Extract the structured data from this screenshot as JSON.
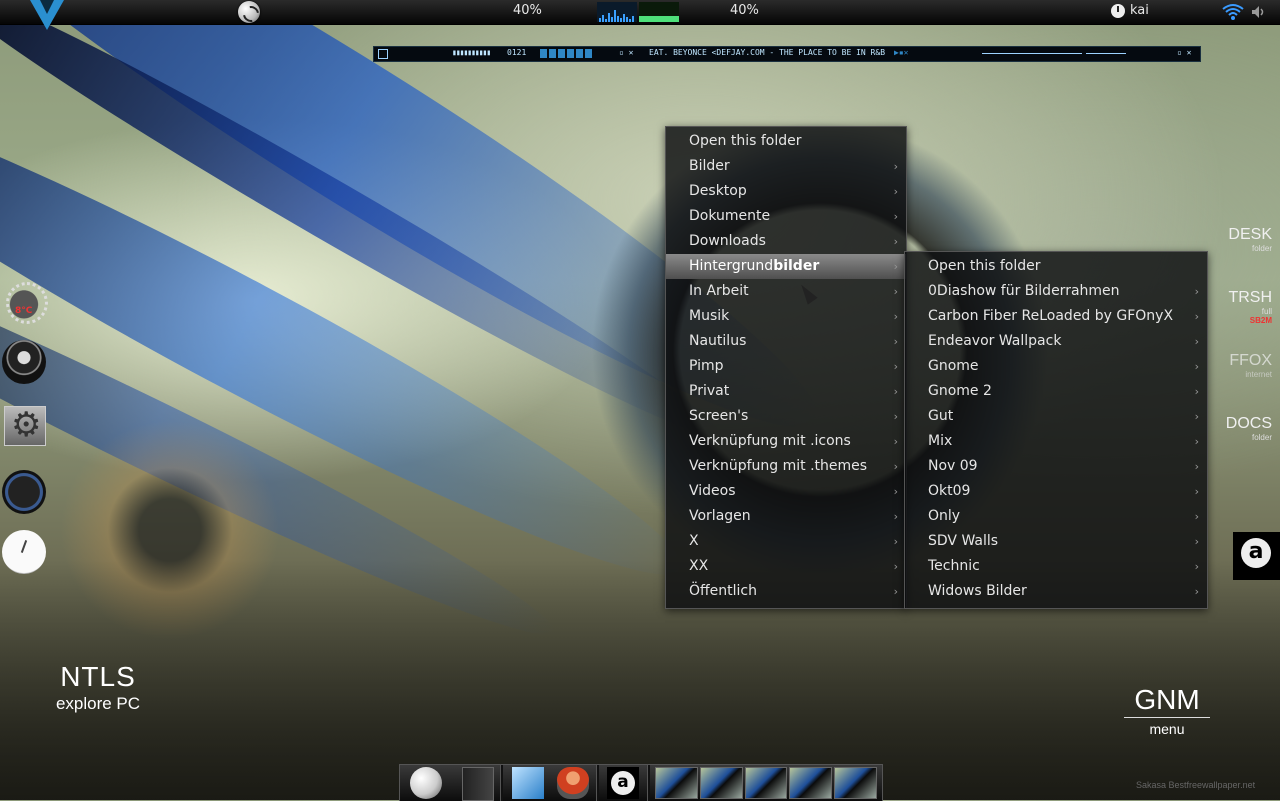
{
  "top_panel": {
    "cpu1": "40%",
    "cpu2": "40%",
    "user": "kai"
  },
  "media_player": {
    "time": "0121",
    "track": "EAT. BEYONCE <DEFJAY.COM - THE PLACE TO BE IN R&B",
    "left_icon": "player-menu-icon"
  },
  "menu_main": {
    "items": [
      {
        "label": "Open this folder",
        "has_submenu": false
      },
      {
        "label": "Bilder",
        "has_submenu": true
      },
      {
        "label": "Desktop",
        "has_submenu": true
      },
      {
        "label": "Dokumente",
        "has_submenu": true
      },
      {
        "label": "Downloads",
        "has_submenu": true
      },
      {
        "label_prefix": "Hintergrund",
        "label_bold": "bilder",
        "has_submenu": true,
        "active": true
      },
      {
        "label": "In Arbeit",
        "has_submenu": true
      },
      {
        "label": "Musik",
        "has_submenu": true
      },
      {
        "label": "Nautilus",
        "has_submenu": true
      },
      {
        "label": "Pimp",
        "has_submenu": true
      },
      {
        "label": "Privat",
        "has_submenu": true
      },
      {
        "label": "Screen's",
        "has_submenu": true
      },
      {
        "label": "Verknüpfung mit .icons",
        "has_submenu": true
      },
      {
        "label": "Verknüpfung mit .themes",
        "has_submenu": true
      },
      {
        "label": "Videos",
        "has_submenu": true
      },
      {
        "label": "Vorlagen",
        "has_submenu": true
      },
      {
        "label": "X",
        "has_submenu": true
      },
      {
        "label": "XX",
        "has_submenu": true
      },
      {
        "label": "Öffentlich",
        "has_submenu": true
      }
    ]
  },
  "menu_sub": {
    "items": [
      {
        "label": "Open this folder",
        "has_submenu": false
      },
      {
        "label": "0Diashow für Bilderrahmen",
        "has_submenu": true
      },
      {
        "label": "Carbon Fiber ReLoaded by GFOnyX",
        "has_submenu": true
      },
      {
        "label": "Endeavor Wallpack",
        "has_submenu": true
      },
      {
        "label": "Gnome",
        "has_submenu": true
      },
      {
        "label": "Gnome 2",
        "has_submenu": true
      },
      {
        "label": "Gut",
        "has_submenu": true
      },
      {
        "label": "Mix",
        "has_submenu": true
      },
      {
        "label": "Nov 09",
        "has_submenu": true
      },
      {
        "label": "Okt09",
        "has_submenu": true
      },
      {
        "label": "Only",
        "has_submenu": true
      },
      {
        "label": "SDV Walls",
        "has_submenu": true
      },
      {
        "label": "Technic",
        "has_submenu": true
      },
      {
        "label": "Widows Bilder",
        "has_submenu": true
      }
    ]
  },
  "right_launchers": {
    "desk": {
      "big": "DESK",
      "small": "folder"
    },
    "trsh": {
      "big": "TRSH",
      "small": "full",
      "extra": "SB2M"
    },
    "ffox": {
      "big": "FFOX",
      "small": "internet"
    },
    "docs": {
      "big": "DOCS",
      "small": "folder"
    }
  },
  "weather_widget": {
    "temp": "8°C"
  },
  "ntls": {
    "big": "NTLS",
    "sub": "explore PC"
  },
  "gnm": {
    "big": "GNM",
    "sub": "menu"
  },
  "credit": "Sakasa Bestfreewallpaper.net",
  "colors": {
    "accent_blue": "#2a8fd0",
    "menu_bg": "#0c0e10",
    "active_item": "#6a6a6a"
  }
}
